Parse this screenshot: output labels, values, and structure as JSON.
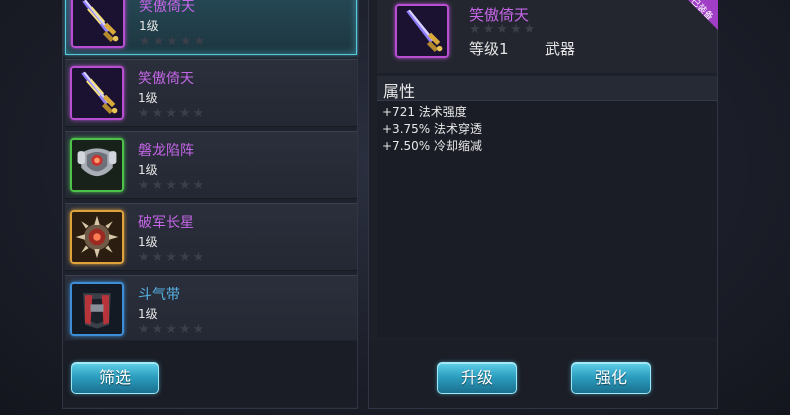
{
  "items": [
    {
      "name": "笑傲倚天",
      "level": "1级",
      "stars": "★★★★★",
      "rarity": "purple",
      "icon": "sword-icon",
      "selected": true
    },
    {
      "name": "笑傲倚天",
      "level": "1级",
      "stars": "★★★★★",
      "rarity": "purple",
      "icon": "sword-icon",
      "selected": false
    },
    {
      "name": "磐龙陷阵",
      "level": "1级",
      "stars": "★★★★★",
      "rarity": "green",
      "icon": "armor-icon",
      "selected": false
    },
    {
      "name": "破军长星",
      "level": "1级",
      "stars": "★★★★★",
      "rarity": "orange",
      "icon": "spiked-orb-icon",
      "selected": false
    },
    {
      "name": "斗气带",
      "level": "1级",
      "stars": "★★★★★",
      "rarity": "blue",
      "icon": "belt-icon",
      "selected": false
    }
  ],
  "filter_button": "筛选",
  "detail": {
    "name": "笑傲倚天",
    "stars": "★★★★★",
    "level": "等级1",
    "type": "武器",
    "ribbon": "已装备"
  },
  "attributes": {
    "title": "属性",
    "lines": [
      "+721 法术强度",
      "+3.75% 法术穿透",
      "+7.50% 冷却缩减"
    ]
  },
  "buttons": {
    "upgrade": "升级",
    "enhance": "强化"
  },
  "colors": {
    "purple_name": "#c565e8",
    "green_name": "#c565e8",
    "accent": "#57c7dc"
  }
}
